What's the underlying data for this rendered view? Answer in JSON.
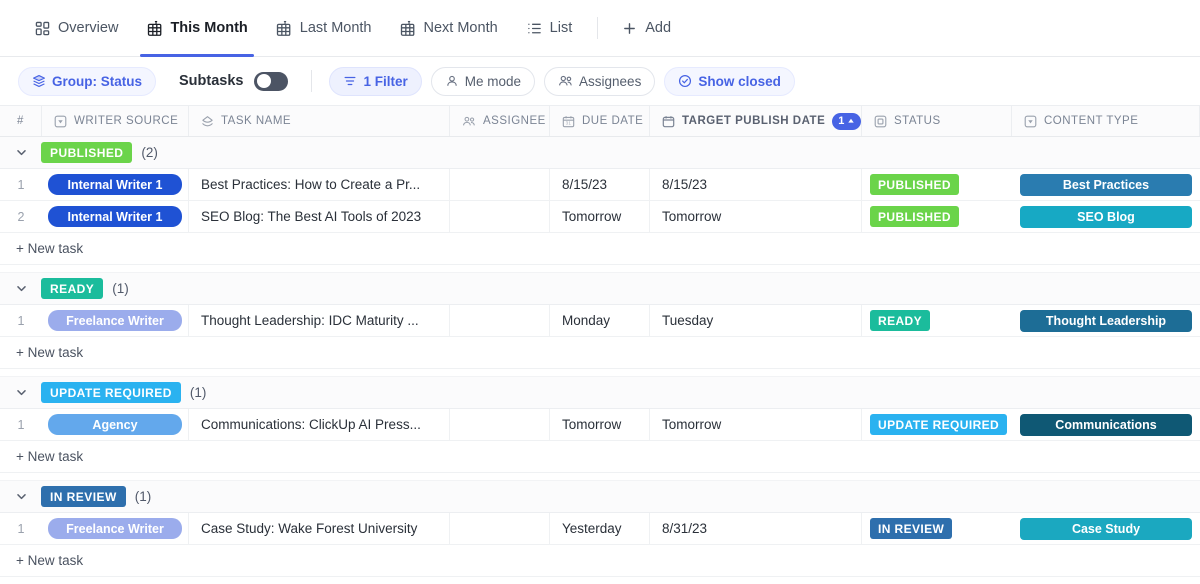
{
  "tabs": [
    {
      "label": "Overview",
      "icon": "grid-icon",
      "active": false
    },
    {
      "label": "This Month",
      "icon": "table-pin-icon",
      "active": true
    },
    {
      "label": "Last Month",
      "icon": "table-pin-icon",
      "active": false
    },
    {
      "label": "Next Month",
      "icon": "table-pin-icon",
      "active": false
    },
    {
      "label": "List",
      "icon": "list-icon",
      "active": false
    }
  ],
  "add_tab": {
    "label": "Add",
    "icon": "plus-icon"
  },
  "toolbar": {
    "group_chip": {
      "label": "Group: Status",
      "icon": "layers-icon"
    },
    "subtasks_label": "Subtasks",
    "subtasks_toggle_state": "off",
    "filter_chip": {
      "label": "1 Filter",
      "icon": "filter-icon"
    },
    "me_mode_chip": {
      "label": "Me mode",
      "icon": "person-icon"
    },
    "assignees_chip": {
      "label": "Assignees",
      "icon": "people-icon"
    },
    "show_closed_chip": {
      "label": "Show closed",
      "icon": "check-circle-icon"
    }
  },
  "columns": [
    {
      "key": "idx",
      "label": "#",
      "icon": null
    },
    {
      "key": "src",
      "label": "WRITER SOURCE",
      "icon": "dropdown-field-icon"
    },
    {
      "key": "name",
      "label": "TASK NAME",
      "icon": "task-icon"
    },
    {
      "key": "asgn",
      "label": "ASSIGNEE",
      "icon": "people-icon"
    },
    {
      "key": "due",
      "label": "DUE DATE",
      "icon": "calendar-icon"
    },
    {
      "key": "tpd",
      "label": "TARGET PUBLISH DATE",
      "icon": "date-field-icon",
      "sort_badge": "1",
      "sort_dir": "asc"
    },
    {
      "key": "stat",
      "label": "STATUS",
      "icon": "status-field-icon"
    },
    {
      "key": "type",
      "label": "CONTENT TYPE",
      "icon": "dropdown-field-icon"
    }
  ],
  "new_task_label": "+ New task",
  "colors": {
    "accent": "#4763e4",
    "published": "#6bd44a",
    "ready": "#1bbc9c",
    "update_required": "#2ab2f0",
    "in_review": "#2e6fad",
    "internal_writer": "#1f52d4",
    "freelance_writer": "#9bacec",
    "agency": "#63a8ec",
    "type_best_practices": "#2a7cb0",
    "type_seo_blog": "#17a9c4",
    "type_thought_leadership": "#1d6d96",
    "type_communications": "#0f5874",
    "type_case_study": "#1ba8c0"
  },
  "groups": [
    {
      "status": "PUBLISHED",
      "status_color": "#6bd44a",
      "count": "(2)",
      "rows": [
        {
          "idx": "1",
          "source": "Internal Writer 1",
          "source_color": "#1f52d4",
          "name": "Best Practices: How to Create a Pr...",
          "assignee": "",
          "due": "8/15/23",
          "target_publish": "8/15/23",
          "status": "PUBLISHED",
          "status_color": "#6bd44a",
          "content_type": "Best Practices",
          "content_type_color": "#2a7cb0"
        },
        {
          "idx": "2",
          "source": "Internal Writer 1",
          "source_color": "#1f52d4",
          "name": "SEO Blog: The Best AI Tools of 2023",
          "assignee": "",
          "due": "Tomorrow",
          "target_publish": "Tomorrow",
          "status": "PUBLISHED",
          "status_color": "#6bd44a",
          "content_type": "SEO Blog",
          "content_type_color": "#17a9c4"
        }
      ]
    },
    {
      "status": "READY",
      "status_color": "#1bbc9c",
      "count": "(1)",
      "rows": [
        {
          "idx": "1",
          "source": "Freelance Writer",
          "source_color": "#9bacec",
          "name": "Thought Leadership: IDC Maturity ...",
          "assignee": "",
          "due": "Monday",
          "target_publish": "Tuesday",
          "status": "READY",
          "status_color": "#1bbc9c",
          "content_type": "Thought Leadership",
          "content_type_color": "#1d6d96"
        }
      ]
    },
    {
      "status": "UPDATE REQUIRED",
      "status_color": "#2ab2f0",
      "count": "(1)",
      "rows": [
        {
          "idx": "1",
          "source": "Agency",
          "source_color": "#63a8ec",
          "name": "Communications: ClickUp AI Press...",
          "assignee": "",
          "due": "Tomorrow",
          "target_publish": "Tomorrow",
          "status": "UPDATE REQUIRED",
          "status_color": "#2ab2f0",
          "content_type": "Communications",
          "content_type_color": "#0f5874"
        }
      ]
    },
    {
      "status": "IN REVIEW",
      "status_color": "#2e6fad",
      "count": "(1)",
      "rows": [
        {
          "idx": "1",
          "source": "Freelance Writer",
          "source_color": "#9bacec",
          "name": "Case Study: Wake Forest University",
          "assignee": "",
          "due": "Yesterday",
          "target_publish": "8/31/23",
          "status": "IN REVIEW",
          "status_color": "#2e6fad",
          "content_type": "Case Study",
          "content_type_color": "#1ba8c0"
        }
      ]
    }
  ]
}
